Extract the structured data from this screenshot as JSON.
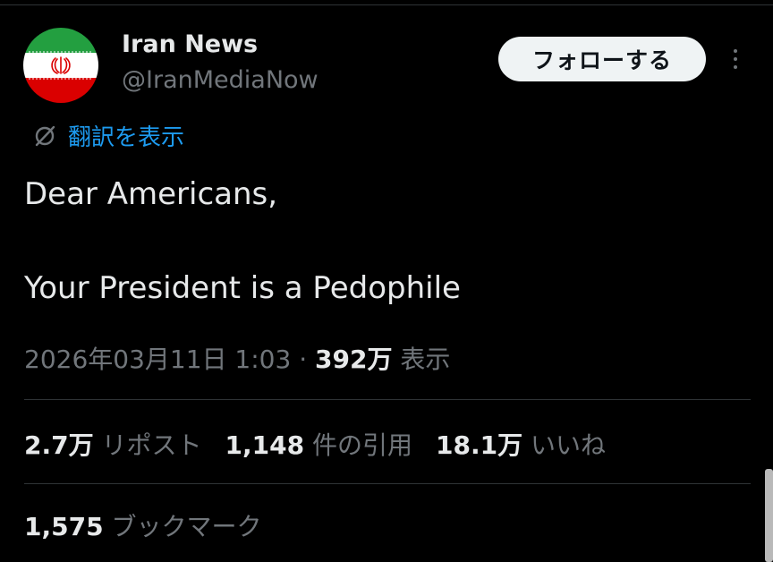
{
  "account": {
    "name": "Iran News",
    "handle": "@IranMediaNow",
    "avatar_icon": "iran-flag-icon",
    "flag_colors": {
      "green": "#239f40",
      "white": "#ffffff",
      "red": "#da0000"
    }
  },
  "actions": {
    "follow_label": "フォローする",
    "more_icon": "more-dots-icon"
  },
  "translate": {
    "label": "翻訳を表示",
    "icon": "globe-icon"
  },
  "tweet": {
    "line1": "Dear Americans,",
    "line2": "Your President is a Pedophile"
  },
  "meta": {
    "datetime": "2026年03月11日 1:03",
    "separator": " · ",
    "views": "392万",
    "views_label": " 表示"
  },
  "stats": [
    {
      "value": "2.7万",
      "label": " リポスト"
    },
    {
      "value": "1,148",
      "label": " 件の引用"
    },
    {
      "value": "18.1万",
      "label": " いいね"
    }
  ],
  "bookmarks": {
    "value": "1,575",
    "label": " ブックマーク"
  },
  "colors": {
    "background": "#000000",
    "text": "#e7e9ea",
    "muted": "#71767b",
    "link": "#1d9bf0",
    "divider": "#2f3336"
  }
}
